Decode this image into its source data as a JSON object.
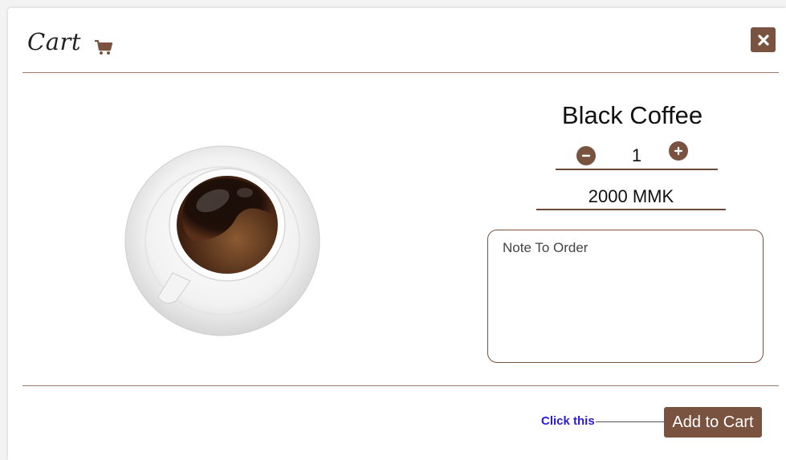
{
  "header": {
    "title": "Cart",
    "cart_icon": "shopping-cart-icon",
    "close_icon": "close-icon"
  },
  "product": {
    "name": "Black Coffee",
    "quantity": "1",
    "price": "2000 MMK",
    "image": "coffee-cup-icon"
  },
  "note": {
    "placeholder": "Note To Order"
  },
  "footer": {
    "hint": "Click this",
    "add_label": "Add to Cart"
  },
  "colors": {
    "accent": "#7a5340",
    "hint": "#2a1bd8"
  }
}
